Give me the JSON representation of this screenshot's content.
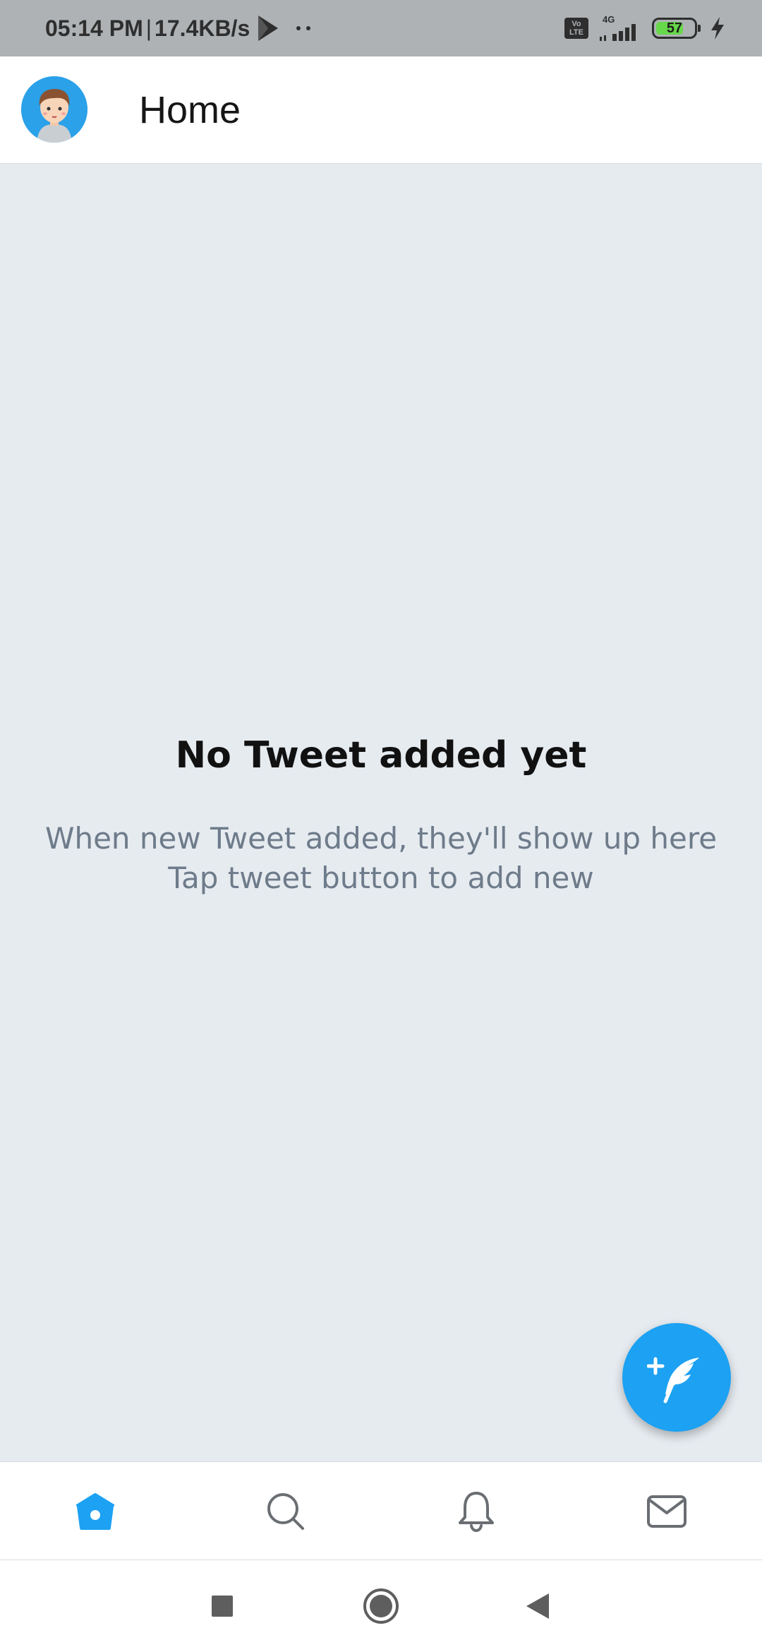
{
  "status_bar": {
    "time": "05:14 PM",
    "network_speed": "17.4KB/s",
    "volte_label": "Vo LTE",
    "network_type": "4G",
    "battery_level": "57",
    "icons": [
      "play-icon",
      "more-dots-icon",
      "volte-icon",
      "signal-icon",
      "battery-icon",
      "charging-bolt-icon"
    ]
  },
  "header": {
    "title": "Home",
    "avatar_icon": "user-avatar"
  },
  "empty_state": {
    "title": "No Tweet added yet",
    "subtitle_line1": "When new Tweet added, they'll show up here",
    "subtitle_line2": "Tap tweet button to add new"
  },
  "fab": {
    "icon": "add-tweet-feather-icon"
  },
  "bottom_nav": {
    "items": [
      {
        "icon": "home-icon",
        "active": true
      },
      {
        "icon": "search-icon",
        "active": false
      },
      {
        "icon": "bell-icon",
        "active": false
      },
      {
        "icon": "mail-icon",
        "active": false
      }
    ]
  },
  "system_nav": {
    "icons": [
      "recents-square-icon",
      "home-circle-icon",
      "back-triangle-icon"
    ]
  },
  "colors": {
    "accent": "#1da1f2",
    "background": "#e6ebf0",
    "status_bar": "#aeb2b5",
    "subtitle_text": "#6e7b8a",
    "inactive_icon": "#6a6e73"
  }
}
